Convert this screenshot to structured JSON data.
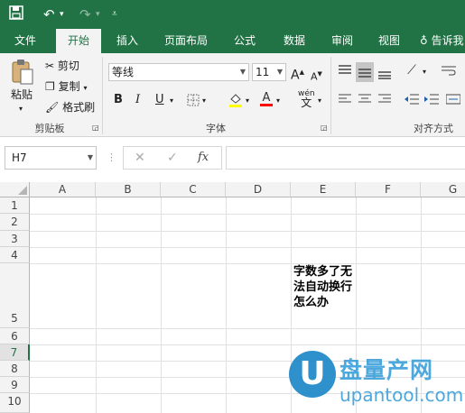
{
  "qat": {
    "save_icon": "save-icon",
    "undo_icon": "undo-icon",
    "redo_icon": "redo-icon",
    "customize_icon": "customize-icon"
  },
  "tabs": [
    "文件",
    "开始",
    "插入",
    "页面布局",
    "公式",
    "数据",
    "审阅",
    "视图",
    "告诉我"
  ],
  "active_tab": "开始",
  "colors": {
    "brand": "#217346",
    "underline_yellow": "#ffff00",
    "underline_red": "#ff0000"
  },
  "clipboard": {
    "paste": "粘贴",
    "cut": "剪切",
    "copy": "复制",
    "format_painter": "格式刷",
    "group": "剪贴板"
  },
  "font": {
    "name": "等线",
    "size": "11",
    "bold": "B",
    "italic": "I",
    "underline": "U",
    "grow": "A",
    "shrink": "A",
    "wen": "wén",
    "group": "字体"
  },
  "alignment": {
    "group": "对齐方式"
  },
  "formula_bar": {
    "name_box": "H7",
    "fx": "fx",
    "content": ""
  },
  "columns": [
    "A",
    "B",
    "C",
    "D",
    "E",
    "F",
    "G"
  ],
  "rows": [
    "1",
    "2",
    "3",
    "4",
    "5",
    "6",
    "7",
    "8",
    "9",
    "10"
  ],
  "cell_e5": "字数多了无法自动换行怎么办",
  "watermark": {
    "letter": "U",
    "title": "盘量产网",
    "url": "upantool.com"
  }
}
